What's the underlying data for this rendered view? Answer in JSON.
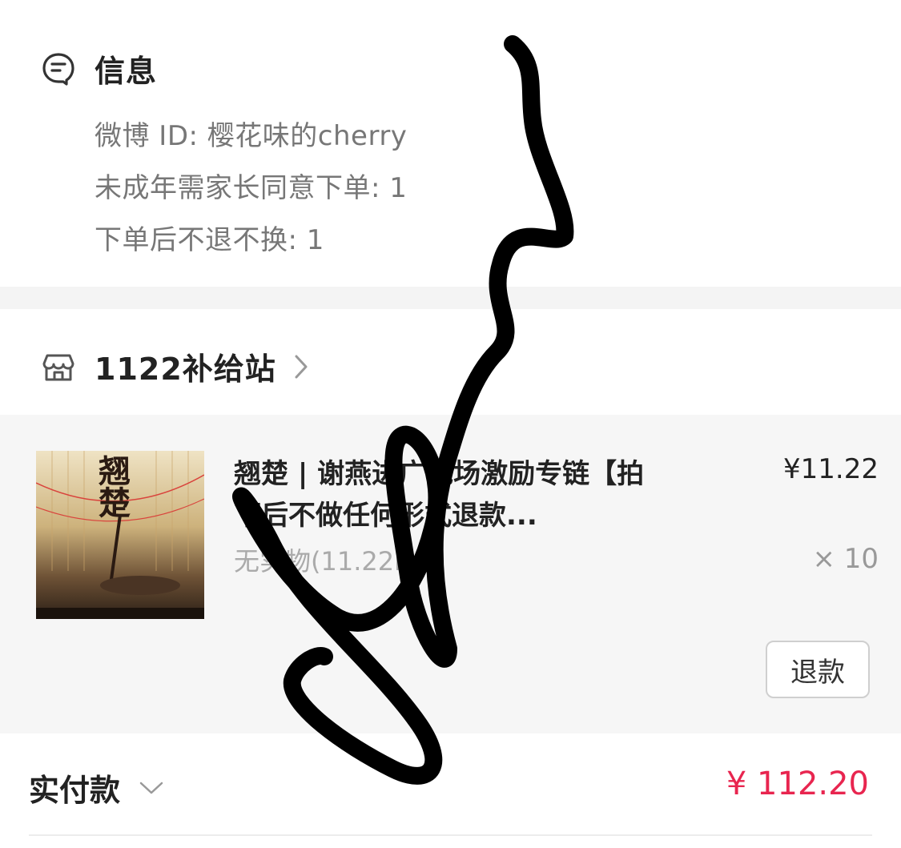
{
  "info": {
    "title": "信息",
    "icon": "notes-icon",
    "lines": [
      "微博 ID: 樱花味的cherry",
      "未成年需家长同意下单: 1",
      "下单后不退不换: 1"
    ]
  },
  "store": {
    "name": "1122补给站",
    "icon": "store-icon"
  },
  "item": {
    "title": "翘楚 | 谢燕进广包场激励专链【拍下后不做任何形式退款...",
    "spec": "无实物(11.22r)",
    "price": "¥11.22",
    "quantity": "× 10",
    "refund_label": "退款",
    "image_caption": "翘楚"
  },
  "total": {
    "label": "实付款",
    "amount": "¥ 112.20",
    "amount_color": "#e8254f"
  }
}
